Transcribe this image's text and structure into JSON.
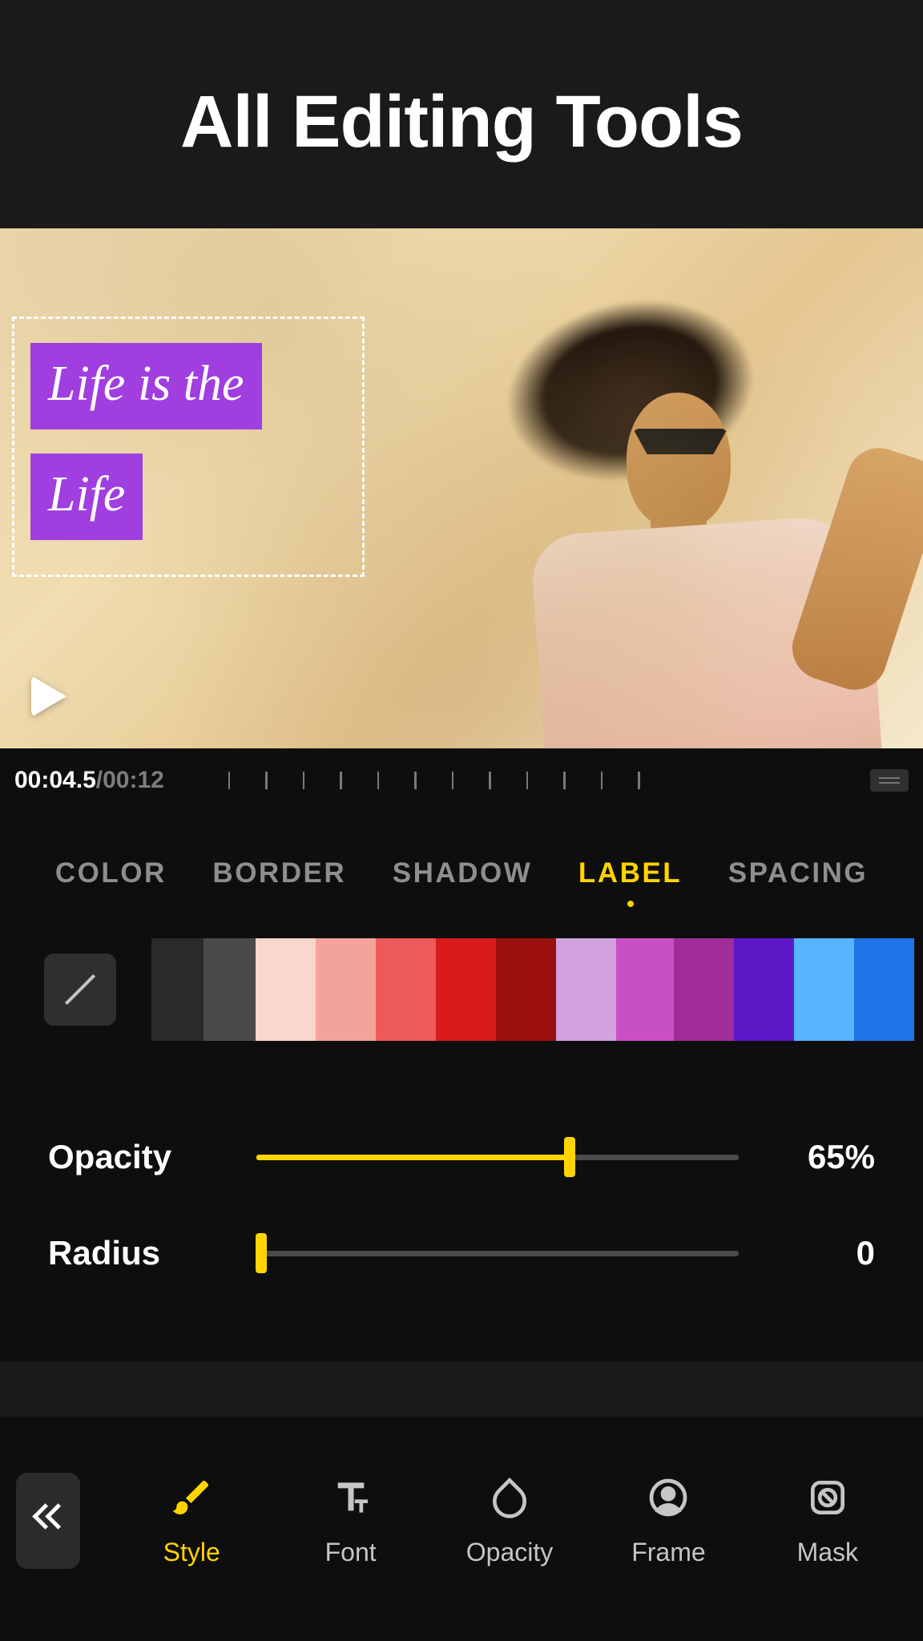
{
  "header": {
    "title": "All Editing Tools"
  },
  "overlay_text": {
    "line1": "Life is the",
    "line2": "Life"
  },
  "time": {
    "current": "00:04.5",
    "separator": "/",
    "total": "00:12"
  },
  "tabs": {
    "items": [
      "COLOR",
      "BORDER",
      "SHADOW",
      "LABEL",
      "SPACING"
    ],
    "active_index": 3
  },
  "swatches": {
    "colors": [
      "#2a2a2a",
      "#4a4a4a",
      "#f9d7cc",
      "#f4a39a",
      "#ec5a5a",
      "#d91b1b",
      "#9c0f0f",
      "#d2a2df",
      "#c94fc4",
      "#a02d9a",
      "#5d19c8",
      "#56b4ff",
      "#1f74e8"
    ],
    "selected_index": 8
  },
  "sliders": {
    "opacity": {
      "label": "Opacity",
      "value": 65,
      "display": "65%"
    },
    "radius": {
      "label": "Radius",
      "value": 0,
      "display": "0"
    }
  },
  "toolbar": {
    "items": [
      {
        "id": "style",
        "label": "Style",
        "active": true
      },
      {
        "id": "font",
        "label": "Font",
        "active": false
      },
      {
        "id": "opacity",
        "label": "Opacity",
        "active": false
      },
      {
        "id": "frame",
        "label": "Frame",
        "active": false
      },
      {
        "id": "mask",
        "label": "Mask",
        "active": false
      }
    ]
  }
}
